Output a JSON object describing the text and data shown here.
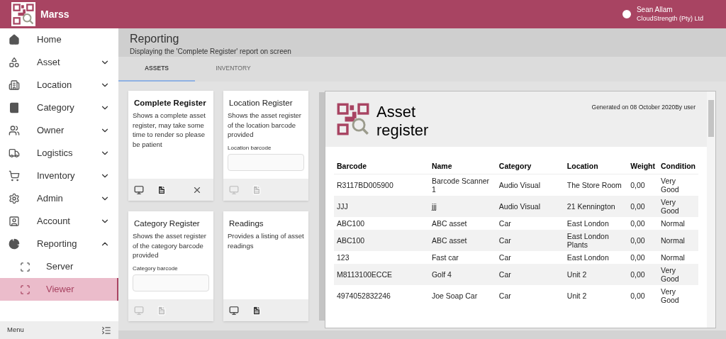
{
  "app": {
    "title": "Marss"
  },
  "user": {
    "name": "Sean Allam",
    "company": "CloudStrength (Pty) Ltd"
  },
  "sidebar": {
    "items": [
      {
        "label": "Home"
      },
      {
        "label": "Asset",
        "expanded": false
      },
      {
        "label": "Location",
        "expanded": false
      },
      {
        "label": "Category",
        "expanded": false
      },
      {
        "label": "Owner",
        "expanded": false
      },
      {
        "label": "Logistics",
        "expanded": false
      },
      {
        "label": "Inventory",
        "expanded": false
      },
      {
        "label": "Admin",
        "expanded": false
      },
      {
        "label": "Account",
        "expanded": false
      },
      {
        "label": "Reporting",
        "expanded": true,
        "children": [
          {
            "label": "Server",
            "selected": false
          },
          {
            "label": "Viewer",
            "selected": true
          }
        ]
      }
    ],
    "footer": "Menu"
  },
  "page": {
    "title": "Reporting",
    "subtitle": "Displaying the 'Complete Register' report on screen"
  },
  "tabs": [
    {
      "label": "ASSETS",
      "selected": true
    },
    {
      "label": "INVENTORY",
      "selected": false
    }
  ],
  "cards": [
    {
      "title": "Complete Register",
      "selected": true,
      "description": "Shows a complete asset register, may take some time to render so please be patient",
      "actions_enabled": true,
      "closable": true
    },
    {
      "title": "Location Register",
      "selected": false,
      "description": "Shows the asset register of the location barcode provided",
      "field_label": "Location barcode",
      "actions_enabled": false,
      "closable": false
    },
    {
      "title": "Category Register",
      "selected": false,
      "description": "Shows the asset register of the category barcode provided",
      "field_label": "Category barcode",
      "actions_enabled": false,
      "closable": false
    },
    {
      "title": "Readings",
      "selected": false,
      "description": "Provides a listing of asset readings",
      "actions_enabled": true,
      "closable": false
    }
  ],
  "report": {
    "title": "Asset register",
    "generated": "Generated on 08 October 2020By user",
    "table": {
      "columns": [
        "Barcode",
        "Name",
        "Category",
        "Location",
        "Weight",
        "Condition"
      ],
      "rows": [
        [
          "R3117BD005900",
          "Barcode Scanner 1",
          "Audio Visual",
          "The Store Room",
          "0,00",
          "Very Good"
        ],
        [
          "JJJ",
          "jjj",
          "Audio Visual",
          "21 Kennington",
          "0,00",
          "Very Good"
        ],
        [
          "ABC100",
          "ABC asset",
          "Car",
          "East London",
          "0,00",
          "Normal"
        ],
        [
          "ABC100",
          "ABC asset",
          "Car",
          "East London Plants",
          "0,00",
          "Normal"
        ],
        [
          "123",
          "Fast car",
          "Car",
          "East London",
          "0,00",
          "Normal"
        ],
        [
          "M8113100ECCE",
          "Golf 4",
          "Car",
          "Unit 2",
          "0,00",
          "Very Good"
        ],
        [
          "4974052832246",
          "Joe Soap Car",
          "Car",
          "Unit 2",
          "0,00",
          "Very Good"
        ]
      ]
    }
  }
}
